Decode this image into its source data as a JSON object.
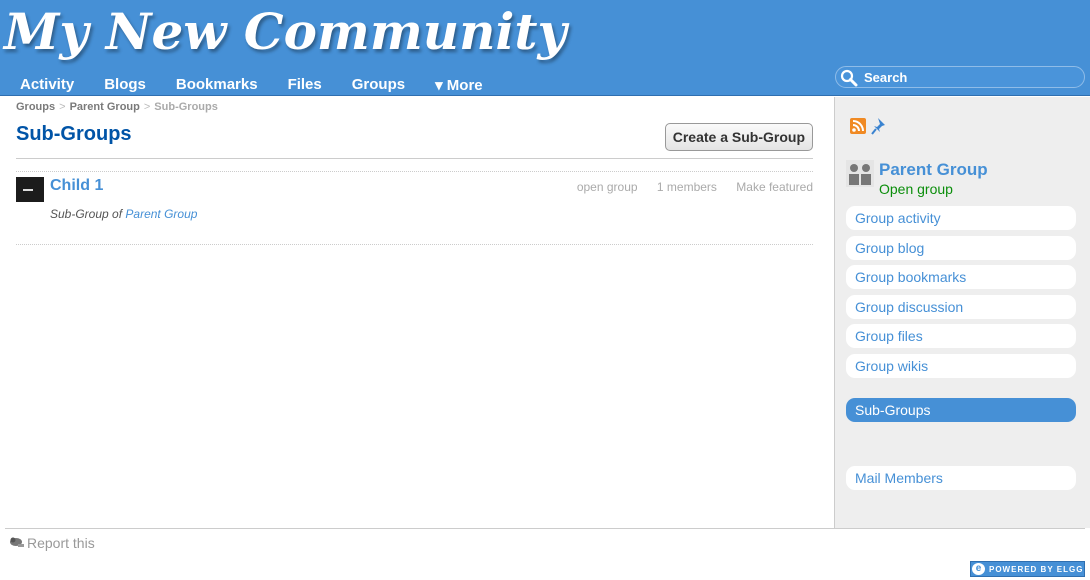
{
  "site": {
    "title": "My New Community"
  },
  "nav": {
    "items": [
      "Activity",
      "Blogs",
      "Bookmarks",
      "Files",
      "Groups",
      "▾ More"
    ]
  },
  "search": {
    "placeholder": "Search"
  },
  "breadcrumb": {
    "items": [
      "Groups",
      "Parent Group",
      "Sub-Groups"
    ]
  },
  "main": {
    "title": "Sub-Groups",
    "create_button": "Create a Sub-Group",
    "items": [
      {
        "title": "Child 1",
        "status": "open group",
        "members": "1 members",
        "action": "Make featured",
        "subtitle_prefix": "Sub-Group of",
        "parent_link": "Parent Group"
      }
    ]
  },
  "sidebar": {
    "owner_name": "Parent Group",
    "owner_status": "Open group",
    "menu": [
      "Group activity",
      "Group blog",
      "Group bookmarks",
      "Group discussion",
      "Group files",
      "Group wikis"
    ],
    "active_item": "Sub-Groups",
    "extra_item": "Mail Members"
  },
  "footer": {
    "report": "Report this",
    "powered_by": "POWERED BY ELGG"
  },
  "colors": {
    "brand": "#4690d6",
    "title": "#0054a7",
    "open_status": "#0b8e0b"
  },
  "icons": [
    "search-icon",
    "rss-icon",
    "pin-icon",
    "group-avatar-icon",
    "report-icon",
    "elgg-logo-icon"
  ]
}
